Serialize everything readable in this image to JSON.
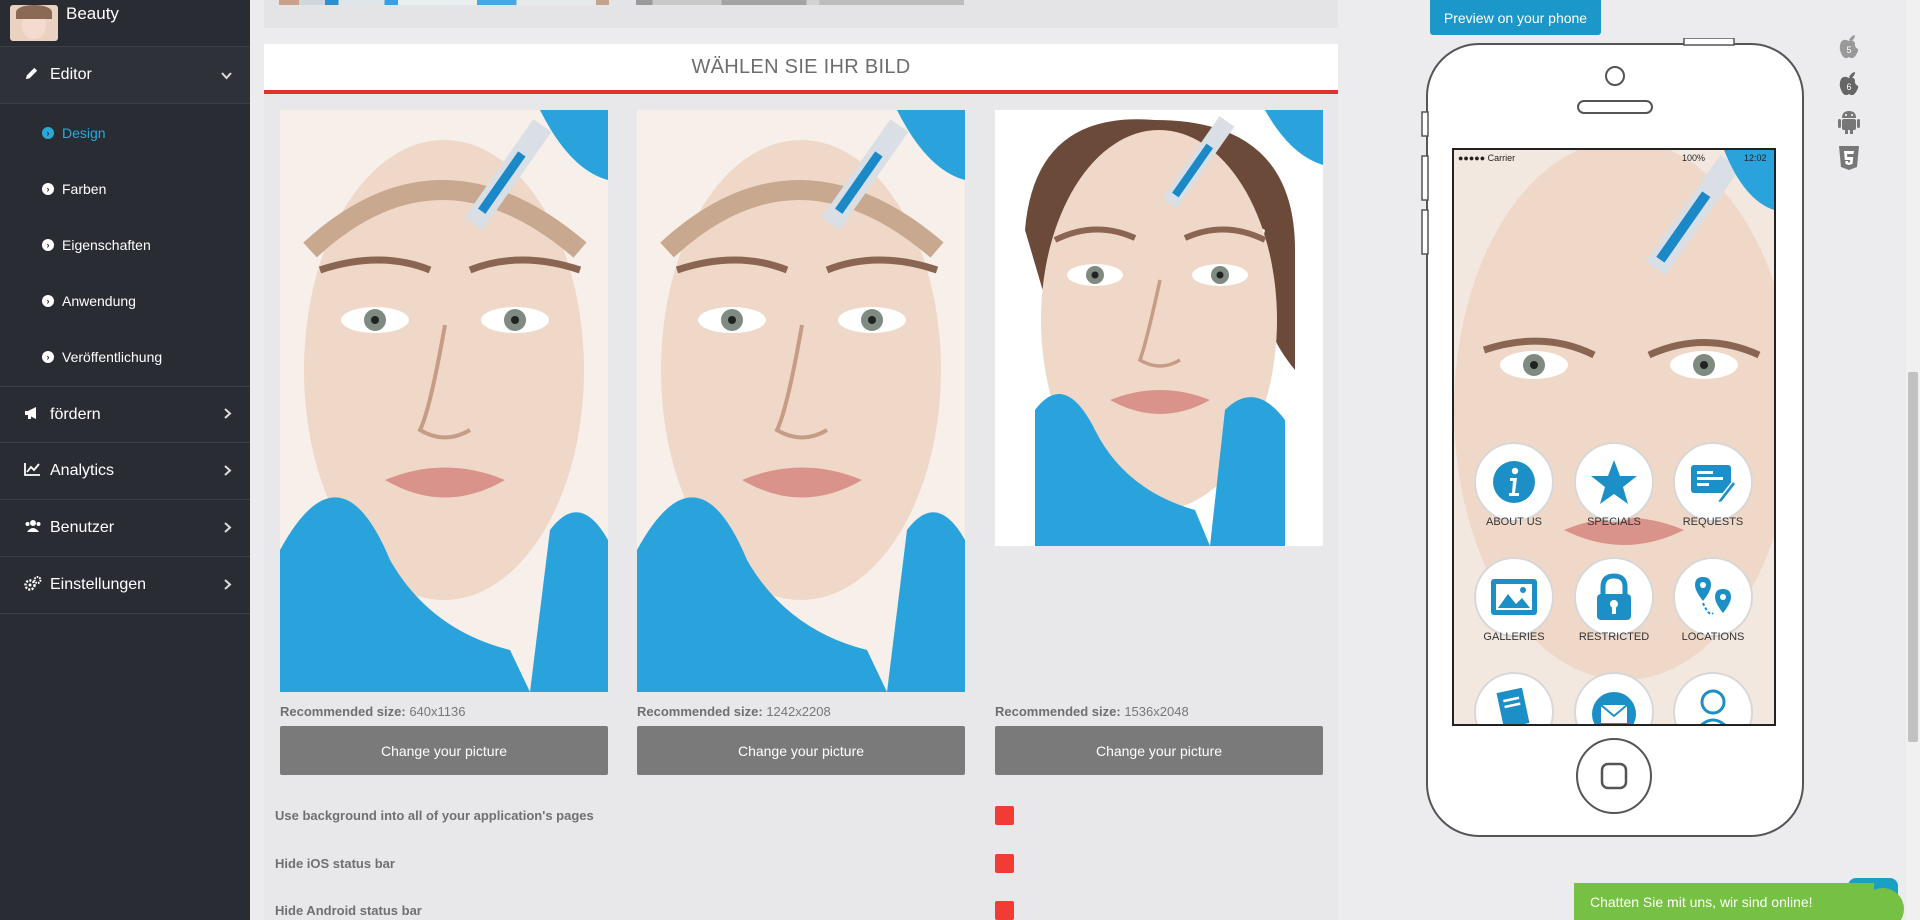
{
  "sidebar": {
    "brand": "Beauty",
    "editor": {
      "label": "Editor"
    },
    "submenu": [
      {
        "label": "Design"
      },
      {
        "label": "Farben"
      },
      {
        "label": "Eigenschaften"
      },
      {
        "label": "Anwendung"
      },
      {
        "label": "Veröffentlichung"
      }
    ],
    "items": [
      {
        "label": "fördern"
      },
      {
        "label": "Analytics"
      },
      {
        "label": "Benutzer"
      },
      {
        "label": "Einstellungen"
      }
    ]
  },
  "panel": {
    "title": "WÄHLEN SIE IHR BILD",
    "recommended_label": "Recommended size:",
    "pictures": [
      {
        "size": "640x1136",
        "button": "Change your picture"
      },
      {
        "size": "1242x2208",
        "button": "Change your picture"
      },
      {
        "size": "1536x2048",
        "button": "Change your picture"
      }
    ],
    "options": [
      {
        "label": "Use background into all of your application's pages",
        "checked": true
      },
      {
        "label": "Hide iOS status bar",
        "checked": true
      },
      {
        "label": "Hide Android status bar",
        "checked": true
      }
    ]
  },
  "preview": {
    "button": "Preview on your phone",
    "status_carrier": "●●●●● Carrier",
    "status_battery": "100%",
    "status_time": "12:02",
    "tiles": [
      {
        "label": "ABOUT US",
        "icon": "info-icon"
      },
      {
        "label": "SPECIALS",
        "icon": "star-icon"
      },
      {
        "label": "REQUESTS",
        "icon": "form-icon"
      },
      {
        "label": "GALLERIES",
        "icon": "image-icon"
      },
      {
        "label": "RESTRICTED",
        "icon": "lock-icon"
      },
      {
        "label": "LOCATIONS",
        "icon": "map-pin-icon"
      }
    ],
    "os_icons": [
      "ios5-icon",
      "ios6-icon",
      "android-icon",
      "html5-icon"
    ],
    "os_icon_numbers": [
      "5",
      "6"
    ]
  },
  "chat": {
    "label": "Chatten Sie mit uns, wir sind online!"
  },
  "colors": {
    "accent": "#2aa9d8",
    "title_rule": "#e1322d",
    "checkbox": "#f23b32",
    "chat": "#76c043",
    "sidebar": "#2a2c33"
  }
}
